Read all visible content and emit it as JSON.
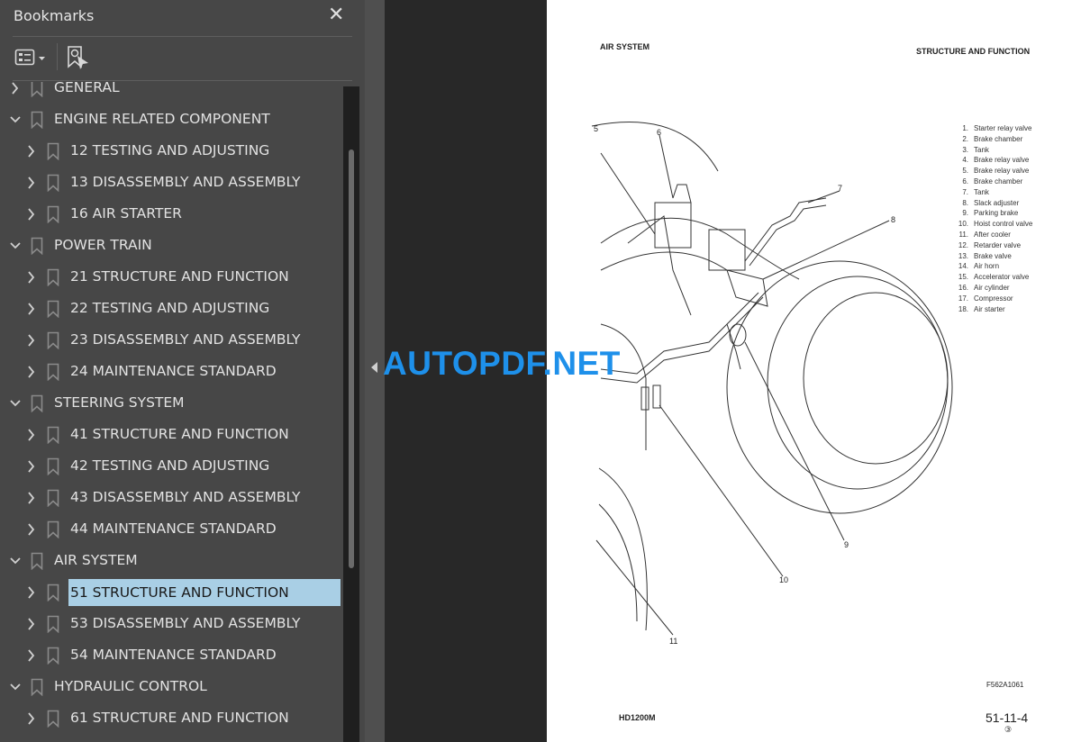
{
  "panel": {
    "title": "Bookmarks",
    "items": [
      {
        "label": "GENERAL",
        "level": 0,
        "expanded": false
      },
      {
        "label": "ENGINE RELATED COMPONENT",
        "level": 0,
        "expanded": true
      },
      {
        "label": "12 TESTING AND ADJUSTING",
        "level": 1,
        "expanded": false
      },
      {
        "label": "13 DISASSEMBLY AND ASSEMBLY",
        "level": 1,
        "expanded": false
      },
      {
        "label": "16 AIR STARTER",
        "level": 1,
        "expanded": false
      },
      {
        "label": "POWER TRAIN",
        "level": 0,
        "expanded": true
      },
      {
        "label": "21 STRUCTURE AND FUNCTION",
        "level": 1,
        "expanded": false
      },
      {
        "label": "22 TESTING AND ADJUSTING",
        "level": 1,
        "expanded": false
      },
      {
        "label": "23 DISASSEMBLY AND ASSEMBLY",
        "level": 1,
        "expanded": false
      },
      {
        "label": "24 MAINTENANCE STANDARD",
        "level": 1,
        "expanded": false
      },
      {
        "label": "STEERING SYSTEM",
        "level": 0,
        "expanded": true
      },
      {
        "label": "41 STRUCTURE AND FUNCTION",
        "level": 1,
        "expanded": false
      },
      {
        "label": "42 TESTING AND ADJUSTING",
        "level": 1,
        "expanded": false
      },
      {
        "label": "43 DISASSEMBLY AND ASSEMBLY",
        "level": 1,
        "expanded": false
      },
      {
        "label": "44 MAINTENANCE STANDARD",
        "level": 1,
        "expanded": false
      },
      {
        "label": "AIR SYSTEM",
        "level": 0,
        "expanded": true
      },
      {
        "label": "51 STRUCTURE AND FUNCTION",
        "level": 1,
        "expanded": false,
        "selected": true
      },
      {
        "label": "53 DISASSEMBLY AND ASSEMBLY",
        "level": 1,
        "expanded": false
      },
      {
        "label": "54 MAINTENANCE STANDARD",
        "level": 1,
        "expanded": false
      },
      {
        "label": "HYDRAULIC CONTROL",
        "level": 0,
        "expanded": true
      },
      {
        "label": "61 STRUCTURE AND FUNCTION",
        "level": 1,
        "expanded": false
      }
    ]
  },
  "document": {
    "header_left": "AIR SYSTEM",
    "header_right": "STRUCTURE AND FUNCTION",
    "legend": [
      {
        "n": "1.",
        "t": "Starter relay valve"
      },
      {
        "n": "2.",
        "t": "Brake chamber"
      },
      {
        "n": "3.",
        "t": "Tank"
      },
      {
        "n": "4.",
        "t": "Brake relay valve"
      },
      {
        "n": "5.",
        "t": "Brake relay valve"
      },
      {
        "n": "6.",
        "t": "Brake chamber"
      },
      {
        "n": "7.",
        "t": "Tank"
      },
      {
        "n": "8.",
        "t": "Slack adjuster"
      },
      {
        "n": "9.",
        "t": "Parking brake"
      },
      {
        "n": "10.",
        "t": "Hoist control valve"
      },
      {
        "n": "11.",
        "t": "After cooler"
      },
      {
        "n": "12.",
        "t": "Retarder valve"
      },
      {
        "n": "13.",
        "t": "Brake valve"
      },
      {
        "n": "14.",
        "t": "Air horn"
      },
      {
        "n": "15.",
        "t": "Accelerator valve"
      },
      {
        "n": "16.",
        "t": "Air cylinder"
      },
      {
        "n": "17.",
        "t": "Compressor"
      },
      {
        "n": "18.",
        "t": "Air starter"
      }
    ],
    "callouts": [
      "5",
      "6",
      "7",
      "8",
      "9",
      "10",
      "11"
    ],
    "figure_id": "F562A1061",
    "model": "HD1200M",
    "page_number": "51-11-4",
    "revision": "③"
  },
  "watermark": "AUTOPDF.NET",
  "colors": {
    "selected_bg": "#a9cfe5",
    "watermark": "#1e90ea",
    "panel_bg": "#474747"
  }
}
